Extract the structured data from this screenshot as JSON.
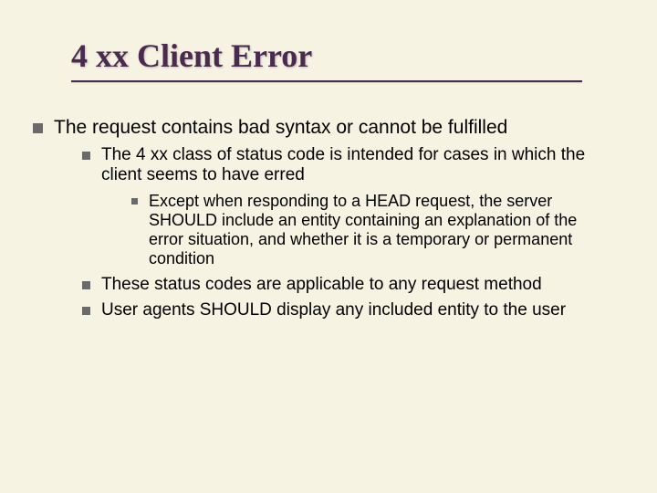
{
  "title": "4 xx Client Error",
  "level1": {
    "text": "The request contains bad syntax or cannot be fulfilled"
  },
  "level2": {
    "a": "The 4 xx class of status code is intended for cases in which the client seems to have erred",
    "b": "These status codes are applicable to any request method",
    "c": "User agents SHOULD display any included entity to the user"
  },
  "level3": {
    "a": "Except when responding to a HEAD request, the server SHOULD include an entity containing an explanation of the error situation, and whether it is a temporary or permanent condition"
  }
}
